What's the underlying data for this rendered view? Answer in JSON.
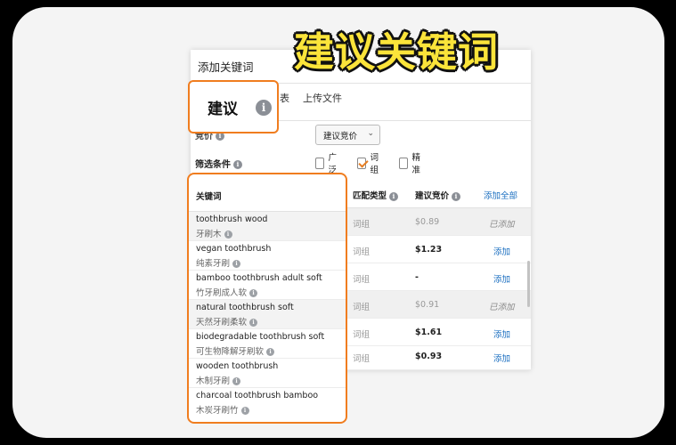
{
  "overlay_title": "建议关键词",
  "panel": {
    "title": "添加关键词",
    "tab_partial": "表",
    "tab_upload": "上传文件",
    "suggested_tab": "建议",
    "bid_label_partial": "竞价",
    "bid_select": "建议竞价",
    "filter_label": "筛选条件",
    "filters": [
      {
        "label": "广泛",
        "checked": false
      },
      {
        "label": "词组",
        "checked": true
      },
      {
        "label": "精准",
        "checked": false
      }
    ]
  },
  "table": {
    "headers": {
      "keyword": "关键词",
      "match_type": "匹配类型",
      "suggested_bid": "建议竞价",
      "add_all": "添加全部"
    },
    "rows": [
      {
        "en": "toothbrush wood",
        "zh": "牙刷木",
        "match": "词组",
        "bid": "$0.89",
        "action": "已添加",
        "added": true
      },
      {
        "en": "vegan toothbrush",
        "zh": "纯素牙刷",
        "match": "词组",
        "bid": "$1.23",
        "action": "添加",
        "added": false
      },
      {
        "en": "bamboo toothbrush adult soft",
        "zh": "竹牙刷成人软",
        "match": "词组",
        "bid": "-",
        "action": "添加",
        "added": false
      },
      {
        "en": "natural toothbrush soft",
        "zh": "天然牙刷柔软",
        "match": "词组",
        "bid": "$0.91",
        "action": "已添加",
        "added": true
      },
      {
        "en": "biodegradable toothbrush soft",
        "zh": "可生物降解牙刷软",
        "match": "词组",
        "bid": "$1.61",
        "action": "添加",
        "added": false
      },
      {
        "en": "wooden toothbrush",
        "zh": "木制牙刷",
        "match": "词组",
        "bid": "$0.93",
        "action": "添加",
        "added": false
      },
      {
        "en": "charcoal toothbrush bamboo",
        "zh": "木炭牙刷竹",
        "match": "",
        "bid": "",
        "action": "",
        "added": false
      }
    ]
  },
  "icons": {
    "info": "info-icon"
  },
  "colors": {
    "highlight": "#f07d1f",
    "link": "#1a6ec0",
    "overlay_text": "#fbe43a"
  }
}
